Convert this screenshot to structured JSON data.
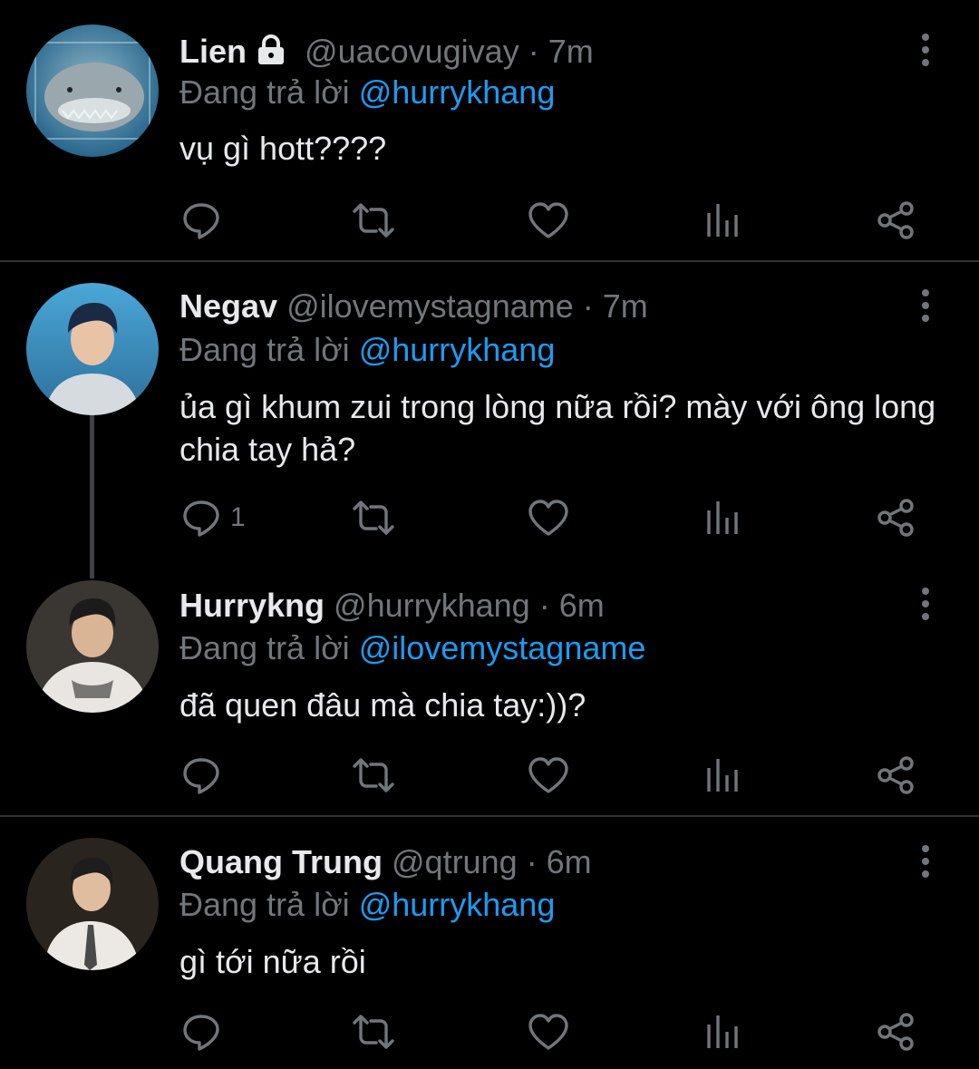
{
  "replying_prefix": "Đang trả lời",
  "colors": {
    "background": "#000000",
    "text": "#e7e9ea",
    "secondary": "#71767b",
    "accent": "#1d9bf0",
    "divider": "#2f3336"
  },
  "tweets": [
    {
      "name": "Lien",
      "protected": true,
      "handle": "@uacovugivay",
      "separator": "·",
      "time": "7m",
      "reply_to": "@hurrykhang",
      "text": "vụ gì hott????",
      "reply_count": "",
      "avatar": "shark-avatar"
    },
    {
      "name": "Negav",
      "protected": false,
      "handle": "@ilovemystagname",
      "separator": "·",
      "time": "7m",
      "reply_to": "@hurrykhang",
      "text": "ủa gì khum zui trong lòng nữa rồi? mày với ông long chia tay hả?",
      "reply_count": "1",
      "avatar": "user-avatar"
    },
    {
      "name": "Hurrykng",
      "protected": false,
      "handle": "@hurrykhang",
      "separator": "·",
      "time": "6m",
      "reply_to": "@ilovemystagname",
      "text": "đã quen đâu mà chia tay:))?",
      "reply_count": "",
      "avatar": "user-avatar"
    },
    {
      "name": "Quang Trung",
      "protected": false,
      "handle": "@qtrung",
      "separator": "·",
      "time": "6m",
      "reply_to": "@hurrykhang",
      "text": "gì tới nữa rồi",
      "reply_count": "",
      "avatar": "user-avatar"
    }
  ],
  "icons": {
    "reply": "reply-icon",
    "retweet": "retweet-icon",
    "like": "heart-icon",
    "views": "views-icon",
    "share": "share-icon",
    "more": "more-vertical-icon",
    "lock": "lock-icon"
  }
}
